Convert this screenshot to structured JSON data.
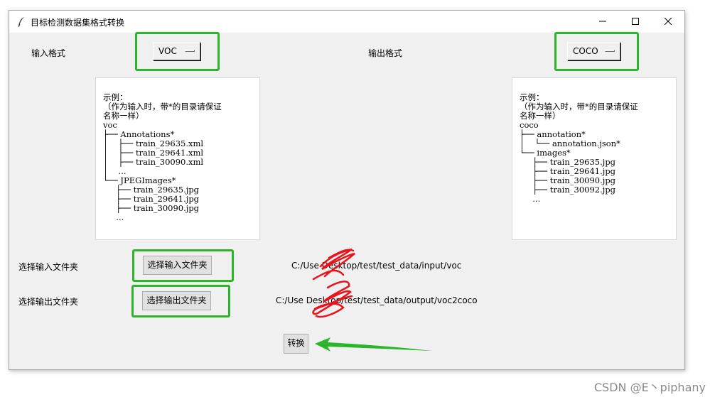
{
  "window": {
    "title": "目标检测数据集格式转换"
  },
  "input_format": {
    "label": "输入格式",
    "value": "VOC"
  },
  "output_format": {
    "label": "输出格式",
    "value": "COCO"
  },
  "input_example": {
    "lines": [
      "示例：",
      "（作为输入时，带*的目录请保证",
      "名称一样）",
      "voc",
      "├── Annotations*",
      "│    ├── train_29635.xml",
      "│    ├── train_29641.xml",
      "│    ├── train_30090.xml",
      "│    ...",
      "└── JPEGImages*",
      "     ├── train_29635.jpg",
      "     ├── train_29641.jpg",
      "     ├── train_30090.jpg",
      "     ..."
    ]
  },
  "output_example": {
    "lines": [
      "示例：",
      "（作为输入时，带*的目录请保证",
      "名称一样）",
      "coco",
      "├── annotation*",
      "│    └── annotation.json*",
      "└── images*",
      "     ├── train_29635.jpg",
      "     ├── train_29641.jpg",
      "     ├── train_30090.jpg",
      "     ├── train_30092.jpg",
      "     ..."
    ]
  },
  "input_folder": {
    "label": "选择输入文件夹",
    "button": "选择输入文件夹",
    "path": "C:/Use              Desktop/test/test_data/input/voc"
  },
  "output_folder": {
    "label": "选择输出文件夹",
    "button": "选择输出文件夹",
    "path": "C:/Use              Desktop/test/test_data/output/voc2coco"
  },
  "convert_button": "转换",
  "watermark": "CSDN @E丶piphany",
  "colors": {
    "highlight": "#2ab52a",
    "redact": "#e8131b"
  }
}
